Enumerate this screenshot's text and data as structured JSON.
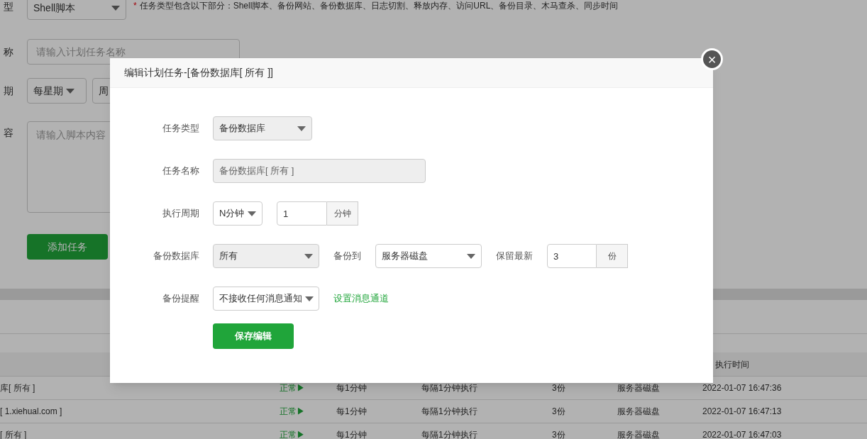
{
  "background": {
    "type_row": {
      "label": "型",
      "value": "Shell脚本",
      "note_mark": "*",
      "note": "任务类型包含以下部分：Shell脚本、备份网站、备份数据库、日志切割、释放内存、访问URL、备份目录、木马查杀、同步时间"
    },
    "name_row": {
      "label": "称",
      "placeholder": "请输入计划任务名称"
    },
    "period_row": {
      "label": "期",
      "selects": [
        "每星期",
        "周"
      ]
    },
    "content_row": {
      "label": "容",
      "placeholder": "请输入脚本内容"
    },
    "add_button": "添加任务",
    "table": {
      "header": "执行时间",
      "rows": [
        {
          "name": "库[ 所有 ]",
          "status": "正常▶",
          "period": "每1分钟",
          "description": "每隔1分钟执行",
          "keep": "3份",
          "destination": "服务器磁盘",
          "time": "2022-01-07 16:47:36"
        },
        {
          "name": "[ 1.xiehual.com ]",
          "status": "正常▶",
          "period": "每1分钟",
          "description": "每隔1分钟执行",
          "keep": "3份",
          "destination": "服务器磁盘",
          "time": "2022-01-07 16:47:13"
        },
        {
          "name": "[ 所有 ]",
          "status": "正常▶",
          "period": "每1分钟",
          "description": "每隔1分钟执行",
          "keep": "3份",
          "destination": "服务器磁盘",
          "time": "2022-01-07 16:47:03"
        }
      ]
    }
  },
  "dialog": {
    "title": "编辑计划任务-[备份数据库[ 所有 ]]",
    "close": "×",
    "rows": [
      {
        "label": "任务类型",
        "controls": [
          {
            "kind": "select",
            "value": "备份数据库",
            "disabled": true
          }
        ]
      },
      {
        "label": "任务名称",
        "controls": [
          {
            "kind": "input",
            "value": "备份数据库[ 所有 ]",
            "disabled": true
          }
        ]
      },
      {
        "label": "执行周期",
        "controls": [
          {
            "kind": "select",
            "value": "N分钟",
            "disabled": false
          },
          {
            "kind": "input",
            "value": "1",
            "addon": "分钟",
            "disabled": false
          }
        ]
      },
      {
        "label": "备份数据库",
        "controls": [
          {
            "kind": "select",
            "value": "所有",
            "disabled": true
          },
          {
            "kind": "label",
            "text": "备份到"
          },
          {
            "kind": "select",
            "value": "服务器磁盘",
            "disabled": false
          },
          {
            "kind": "label",
            "text": "保留最新"
          },
          {
            "kind": "input",
            "value": "3",
            "addon": "份",
            "disabled": false
          }
        ]
      },
      {
        "label": "备份提醒",
        "controls": [
          {
            "kind": "select",
            "value": "不接收任何消息通知",
            "disabled": false
          },
          {
            "kind": "link",
            "text": "设置消息通道"
          }
        ]
      }
    ],
    "save_button": "保存编辑"
  }
}
